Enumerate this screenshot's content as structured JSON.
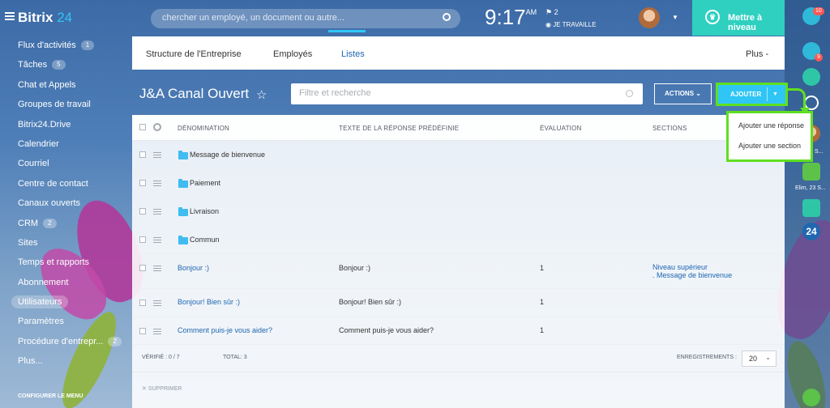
{
  "app": {
    "logo_text": "Bitrix",
    "logo_number": "24"
  },
  "search": {
    "placeholder": "chercher un employé, un document ou autre..."
  },
  "clock": {
    "time": "9:17",
    "ampm": "AM"
  },
  "status": {
    "flags": "2",
    "work_label": "JE TRAVAILLE"
  },
  "upgrade": {
    "label": "Mettre à niveau"
  },
  "sidebar": {
    "items": [
      {
        "label": "Flux d'activités",
        "badge": "1"
      },
      {
        "label": "Tâches",
        "badge": "5"
      },
      {
        "label": "Chat et Appels",
        "badge": ""
      },
      {
        "label": "Groupes de travail",
        "badge": ""
      },
      {
        "label": "Bitrix24.Drive",
        "badge": ""
      },
      {
        "label": "Calendrier",
        "badge": ""
      },
      {
        "label": "Courriel",
        "badge": ""
      },
      {
        "label": "Centre de contact",
        "badge": ""
      },
      {
        "label": "Canaux ouverts",
        "badge": ""
      },
      {
        "label": "CRM",
        "badge": "2"
      },
      {
        "label": "Sites",
        "badge": ""
      },
      {
        "label": "Temps et rapports",
        "badge": ""
      },
      {
        "label": "Abonnement",
        "badge": ""
      },
      {
        "label": "Utilisateurs",
        "badge": ""
      },
      {
        "label": "Paramètres",
        "badge": ""
      },
      {
        "label": "Procédure d'entrepr...",
        "badge": "2"
      },
      {
        "label": "Plus...",
        "badge": ""
      }
    ],
    "configure_label": "CONFIGURER LE MENU"
  },
  "rightbar": {
    "notif_badge_1": "10",
    "notif_badge_2": "9",
    "caption_1": "S...",
    "caption_2": "Elim, 23 S..."
  },
  "tabs": {
    "structure": "Structure de l'Entreprise",
    "employes": "Employés",
    "listes": "Listes",
    "plus": "Plus -"
  },
  "page": {
    "title": "J&A Canal Ouvert"
  },
  "filter": {
    "placeholder": "Filtre et recherche"
  },
  "toolbar": {
    "actions_label": "ACTIONS",
    "add_label": "AJOUTER"
  },
  "dropdown": {
    "items": [
      "Ajouter une réponse",
      "Ajouter une section"
    ]
  },
  "table": {
    "headers": [
      "DÉNOMINATION",
      "TEXTE DE LA RÉPONSE PRÉDÉFINIE",
      "ÉVALUATION",
      "SECTIONS"
    ],
    "folders": [
      "Message de bienvenue",
      "Paiement",
      "Livraison",
      "Commun"
    ],
    "rows": [
      {
        "name": "Bonjour :)",
        "text": "Bonjour :)",
        "rating": "1",
        "section_1": "Niveau supérieur",
        "section_2": ". Message de bienvenue"
      },
      {
        "name": "Bonjour! Bien sûr :)",
        "text": "Bonjour! Bien sûr :)",
        "rating": "1",
        "section_1": "",
        "section_2": ""
      },
      {
        "name": "Comment puis-je vous aider?",
        "text": "Comment puis-je vous aider?",
        "rating": "1",
        "section_1": "",
        "section_2": ""
      }
    ]
  },
  "footer": {
    "checked": "VÉRIFIÉ : 0 / 7",
    "total": "TOTAL: 3",
    "records_label": "ENREGISTREMENTS :",
    "per_page": "20",
    "delete_label": "SUPPRIMER"
  }
}
